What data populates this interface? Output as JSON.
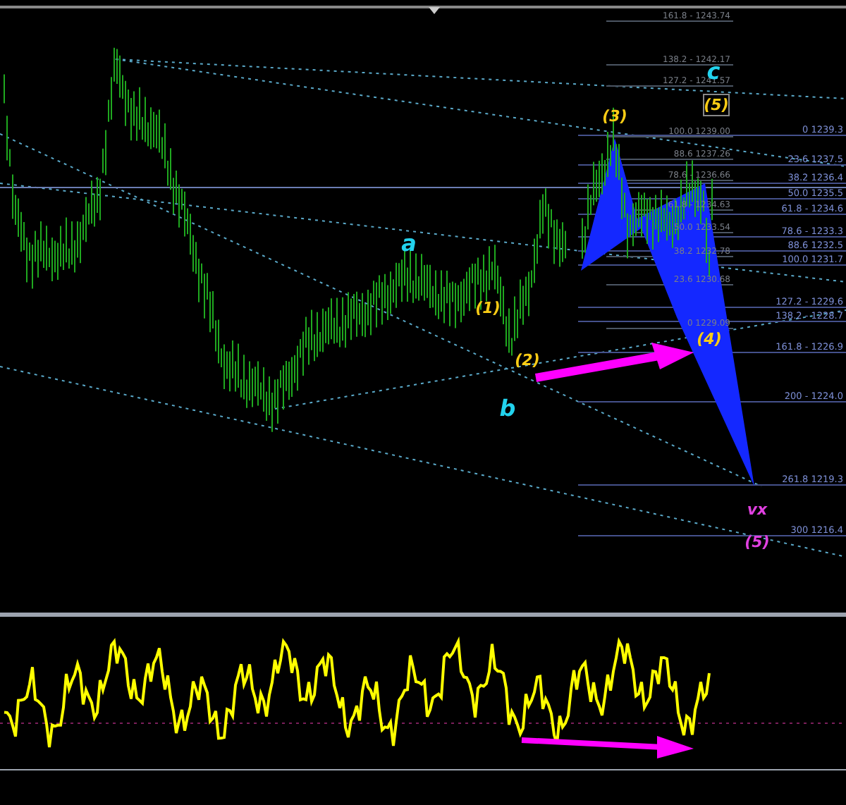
{
  "chart": {
    "wave_labels": [
      {
        "text": "c",
        "kind": "letter"
      },
      {
        "text": "(5)",
        "kind": "boxed"
      },
      {
        "text": "(3)",
        "kind": "impulse"
      },
      {
        "text": "a",
        "kind": "letter"
      },
      {
        "text": "(1)",
        "kind": "impulse"
      },
      {
        "text": "(2)",
        "kind": "impulse"
      },
      {
        "text": "(4)",
        "kind": "impulse"
      },
      {
        "text": "b",
        "kind": "letter"
      },
      {
        "text": "vx",
        "kind": "target"
      },
      {
        "text": "(5)",
        "kind": "target"
      }
    ],
    "fib_levels_left": [
      "161.8 - 1243.74",
      "138.2 - 1242.17",
      "127.2 - 1241.57",
      "100.0 1239.00",
      "88.6 1237.26",
      "78.6 - 1236.66",
      "61.8 - 1234.63",
      "50.0 1233.54",
      "38.2 1232.78",
      "23.6 1230.68",
      "0 1229.09"
    ],
    "fib_levels_right": [
      "0 1239.3",
      "23.6 1237.5",
      "38.2 1236.4",
      "50.0 1235.5",
      "61.8 - 1234.6",
      "78.6 - 1233.3",
      "88.6 1232.5",
      "100.0 1231.7",
      "127.2 - 1229.6",
      "138.2 - 1228.7",
      "161.8 - 1226.9",
      "200 - 1224.0",
      "261.8 1219.3",
      "300 1216.4"
    ]
  }
}
